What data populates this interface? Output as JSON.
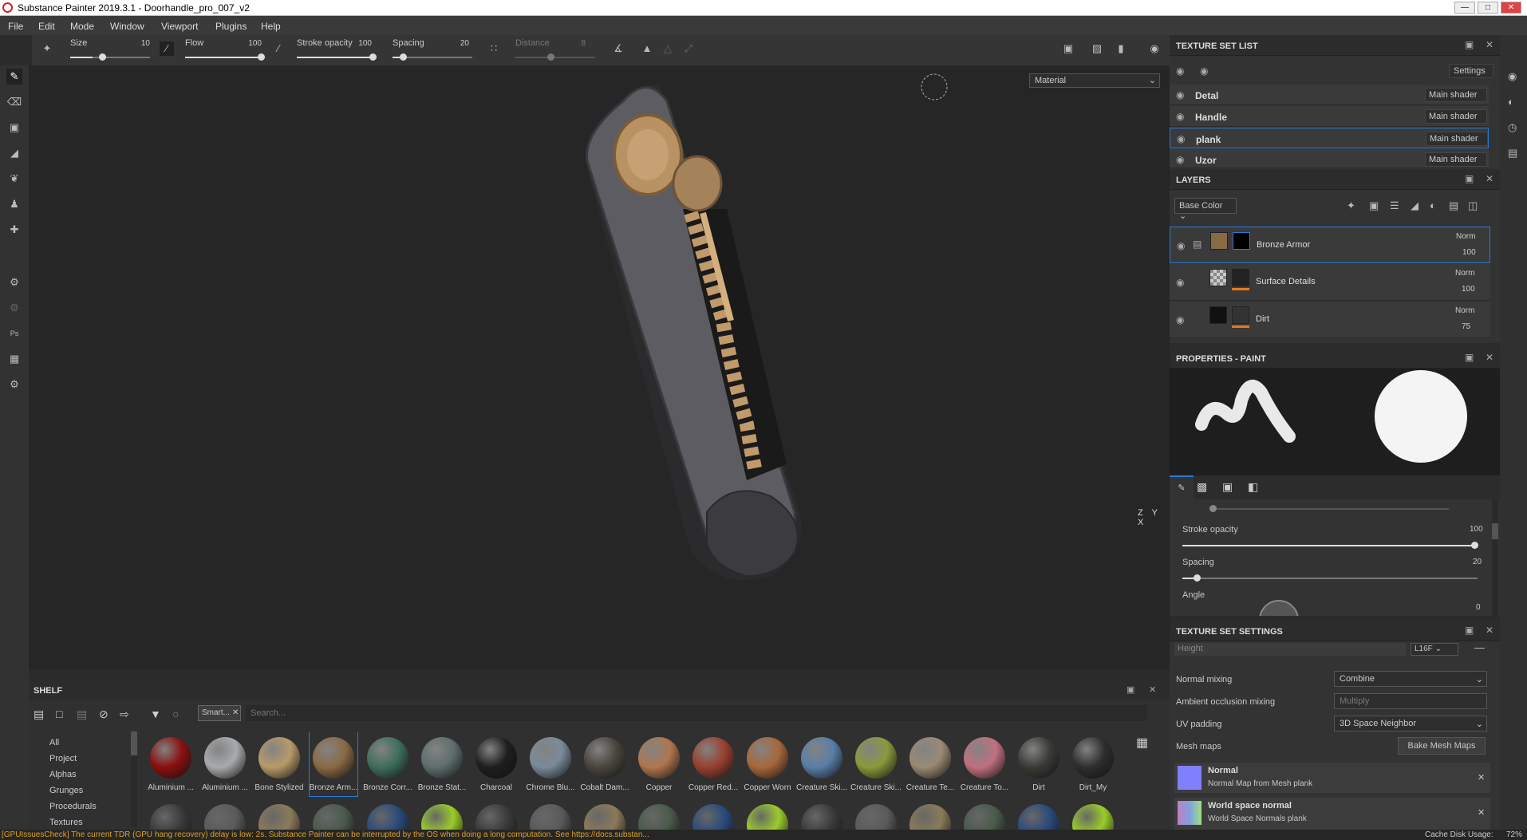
{
  "window": {
    "title": "Substance Painter 2019.3.1 - Doorhandle_pro_007_v2"
  },
  "menu": [
    "File",
    "Edit",
    "Mode",
    "Window",
    "Viewport",
    "Plugins",
    "Help"
  ],
  "toolbar": {
    "size_label": "Size",
    "size_value": "10",
    "flow_label": "Flow",
    "flow_value": "100",
    "stroke_opacity_label": "Stroke opacity",
    "stroke_opacity_value": "100",
    "spacing_label": "Spacing",
    "spacing_value": "20",
    "distance_label": "Distance",
    "distance_value": "8"
  },
  "viewport": {
    "view_mode": "Material",
    "axis_label": "Z Y X"
  },
  "texture_set_list": {
    "title": "TEXTURE SET LIST",
    "settings_label": "Settings",
    "items": [
      {
        "name": "Detal",
        "shader": "Main shader"
      },
      {
        "name": "Handle",
        "shader": "Main shader"
      },
      {
        "name": "plank",
        "shader": "Main shader"
      },
      {
        "name": "Uzor",
        "shader": "Main shader"
      }
    ]
  },
  "layers": {
    "title": "LAYERS",
    "channel": "Base Color",
    "items": [
      {
        "name": "Bronze Armor",
        "blend": "Norm",
        "opacity": "100"
      },
      {
        "name": "Surface Details",
        "blend": "Norm",
        "opacity": "100"
      },
      {
        "name": "Dirt",
        "blend": "Norm",
        "opacity": "75"
      }
    ]
  },
  "properties": {
    "title": "PROPERTIES - PAINT",
    "stroke_opacity_label": "Stroke opacity",
    "stroke_opacity_value": "100",
    "spacing_label": "Spacing",
    "spacing_value": "20",
    "angle_label": "Angle",
    "angle_value": "0"
  },
  "texture_set_settings": {
    "title": "TEXTURE SET SETTINGS",
    "height_placeholder": "Height",
    "height_format": "L16F",
    "normal_mixing_label": "Normal mixing",
    "normal_mixing_value": "Combine",
    "ao_mixing_label": "Ambient occlusion mixing",
    "ao_mixing_value": "Multiply",
    "uv_padding_label": "UV padding",
    "uv_padding_value": "3D Space Neighbor",
    "mesh_maps_label": "Mesh maps",
    "bake_button": "Bake Mesh Maps",
    "maps": [
      {
        "name": "Normal",
        "desc": "Normal Map from Mesh plank"
      },
      {
        "name": "World space normal",
        "desc": "World Space Normals plank"
      }
    ]
  },
  "shelf": {
    "title": "SHELF",
    "filter_tag": "Smart...",
    "search_placeholder": "Search...",
    "categories": [
      "All",
      "Project",
      "Alphas",
      "Grunges",
      "Procedurals",
      "Textures"
    ],
    "materials": [
      {
        "name": "Aluminium ...",
        "color": "#8a1010"
      },
      {
        "name": "Aluminium ...",
        "color": "#a8aaad"
      },
      {
        "name": "Bone Stylized",
        "color": "#b89a6a"
      },
      {
        "name": "Bronze Arm...",
        "color": "#8a6a46"
      },
      {
        "name": "Bronze Corr...",
        "color": "#3e6e5c"
      },
      {
        "name": "Bronze Stat...",
        "color": "#5e6e6c"
      },
      {
        "name": "Charcoal",
        "color": "#1e1e1e"
      },
      {
        "name": "Chrome Blu...",
        "color": "#7a8a9a"
      },
      {
        "name": "Cobalt Dam...",
        "color": "#4a463e"
      },
      {
        "name": "Copper",
        "color": "#b0764e"
      },
      {
        "name": "Copper Red...",
        "color": "#9a4030"
      },
      {
        "name": "Copper Worn",
        "color": "#a8683a"
      },
      {
        "name": "Creature Ski...",
        "color": "#5a7ea8"
      },
      {
        "name": "Creature Ski...",
        "color": "#8a9a3a"
      },
      {
        "name": "Creature Te...",
        "color": "#9a8a74"
      },
      {
        "name": "Creature To...",
        "color": "#c07080"
      },
      {
        "name": "Dirt",
        "color": "#3a3a36"
      },
      {
        "name": "Dirt_My",
        "color": "#2e2e2e"
      }
    ]
  },
  "status": {
    "message": "[GPUIssuesCheck] The current TDR (GPU hang recovery) delay is low: 2s. Substance Painter can be interrupted by the OS when doing a long computation. See https://docs.substan...",
    "cache_label": "Cache Disk Usage:",
    "cache_value": "72%"
  },
  "colors": {
    "accent": "#2a7ad6",
    "status_text": "#e0a020",
    "model_bronze": "#c09a6c",
    "model_steel": "#4a4a4e"
  }
}
